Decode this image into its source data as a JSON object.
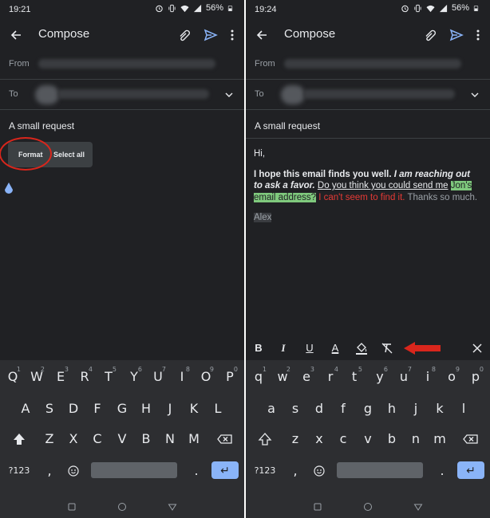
{
  "left": {
    "status": {
      "time": "19:21",
      "battery": "56%"
    },
    "appbar": {
      "title": "Compose"
    },
    "from_label": "From",
    "to_label": "To",
    "subject": "A small request",
    "context_menu": {
      "format": "Format",
      "select_all": "Select all"
    },
    "keyboard": {
      "row1": [
        "Q",
        "W",
        "E",
        "R",
        "T",
        "Y",
        "U",
        "I",
        "O",
        "P"
      ],
      "row1_hints": [
        "1",
        "2",
        "3",
        "4",
        "5",
        "6",
        "7",
        "8",
        "9",
        "0"
      ],
      "row2": [
        "A",
        "S",
        "D",
        "F",
        "G",
        "H",
        "J",
        "K",
        "L"
      ],
      "row3": [
        "Z",
        "X",
        "C",
        "V",
        "B",
        "N",
        "M"
      ],
      "sym": "?123",
      "comma": ",",
      "period": "."
    }
  },
  "right": {
    "status": {
      "time": "19:24",
      "battery": "56%"
    },
    "appbar": {
      "title": "Compose"
    },
    "from_label": "From",
    "to_label": "To",
    "subject": "A small request",
    "body": {
      "greeting": "Hi,",
      "bold": "I hope this email finds you well.",
      "bold_italic": "I am reaching out to ask a favor.",
      "underline": "Do you think you could send me",
      "highlight": "Jon's email address?",
      "red": "I can't seem to find it.",
      "gray": "Thanks so much.",
      "signature": "Alex"
    },
    "format_bar": {
      "bold": "B",
      "italic": "I",
      "underline": "U",
      "text_color": "A"
    },
    "keyboard": {
      "row1": [
        "q",
        "w",
        "e",
        "r",
        "t",
        "y",
        "u",
        "i",
        "o",
        "p"
      ],
      "row1_hints": [
        "1",
        "2",
        "3",
        "4",
        "5",
        "6",
        "7",
        "8",
        "9",
        "0"
      ],
      "row2": [
        "a",
        "s",
        "d",
        "f",
        "g",
        "h",
        "j",
        "k",
        "l"
      ],
      "row3": [
        "z",
        "x",
        "c",
        "v",
        "b",
        "n",
        "m"
      ],
      "sym": "?123",
      "comma": ",",
      "period": "."
    }
  },
  "colors": {
    "background": "#202124",
    "accent": "#8ab4f8",
    "annotation": "#d9261c",
    "highlight": "#7fc97d",
    "red_text": "#e53935"
  },
  "icons": [
    "back-arrow-icon",
    "attach-icon",
    "send-icon",
    "more-vert-icon",
    "chevron-down-icon",
    "text-handle-icon",
    "shift-icon",
    "backspace-icon",
    "emoji-icon",
    "enter-icon",
    "clear-format-icon",
    "fill-color-icon",
    "close-icon",
    "red-arrow-icon"
  ]
}
